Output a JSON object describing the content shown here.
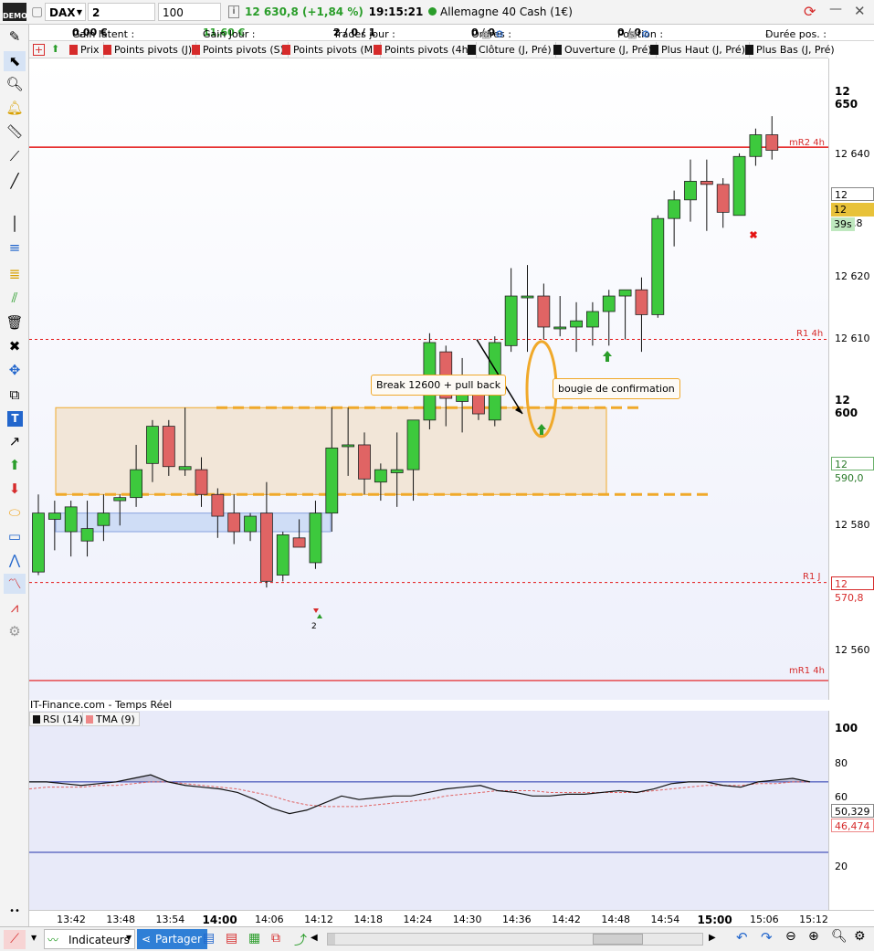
{
  "toolbar": {
    "instrument": "DAX",
    "timeframe": "2 minutes",
    "size": "100 unités",
    "price": "12 630,8 (+1,84 %)",
    "time": "19:15:21",
    "market": "Allemagne 40 Cash (1€)",
    "demo_label": "DEMO"
  },
  "info": {
    "gain_latent_label": "Gain latent :",
    "gain_latent_value": "0,00 €",
    "gain_jour_label": "Gain Jour :",
    "gain_jour_value": "11,60 €",
    "trades_label": "Trades jour :",
    "trades_value": "2 / 0 / 1",
    "ordres_label": "Ordres :",
    "ordres_value_a": "0",
    "ordres_value_b": "0",
    "position_label": "Position :",
    "position_value_a": "0",
    "position_value_b": "0",
    "duree_label": "Durée pos. :",
    "duree_value": "-"
  },
  "indicators": [
    {
      "label": "Prix",
      "color": "#d62b2b"
    },
    {
      "label": "Points pivots (J)",
      "color": "#d62b2b"
    },
    {
      "label": "Points pivots (S)",
      "color": "#d62b2b"
    },
    {
      "label": "Points pivots (M)",
      "color": "#d62b2b"
    },
    {
      "label": "Points pivots (4h)",
      "color": "#d62b2b"
    },
    {
      "label": "Clôture (J, Pré)",
      "color": "#111111"
    },
    {
      "label": "Ouverture (J, Pré)",
      "color": "#111111"
    },
    {
      "label": "Plus Haut (J, Pré)",
      "color": "#111111"
    },
    {
      "label": "Plus Bas (J, Pré)",
      "color": "#111111"
    }
  ],
  "price_axis": {
    "ticks": [
      "12 650",
      "12 640",
      "12 620",
      "12 610",
      "12 600",
      "12 580",
      "12 560"
    ],
    "tags": {
      "p1": "12 633,3",
      "current": "12 630,8",
      "countdown": "39s",
      "p2": "12 590,0",
      "p3": "12 570,8"
    }
  },
  "levels": {
    "mr2_label": "mR2 4h",
    "r1_4h_label": "R1 4h",
    "r1_j_label": "R1 J",
    "mr1_label": "mR1 4h"
  },
  "annotations": {
    "break": "Break 12600 + pull back",
    "confirm": "bougie de confirmation",
    "trade_count": "2"
  },
  "rsi": {
    "source": "IT-Finance.com - Temps Réel",
    "rsi_label": "RSI (14)",
    "tma_label": "TMA (9)",
    "ticks": [
      "100",
      "80",
      "60",
      "20"
    ],
    "value_rsi": "50,329",
    "value_tma": "46,474"
  },
  "time_axis": {
    "labels": [
      "13:42",
      "13:48",
      "13:54",
      "14:00",
      "14:06",
      "14:12",
      "14:18",
      "14:24",
      "14:30",
      "14:36",
      "14:42",
      "14:48",
      "14:54",
      "15:00",
      "15:06",
      "15:12"
    ]
  },
  "bottombar": {
    "indicateurs": "Indicateurs",
    "partager": "Partager"
  },
  "colors": {
    "bull": "#3dc93d",
    "bear": "#e06464",
    "pivot": "#e41414",
    "zone_fill": "#f2e6d8",
    "zone_border": "#f0a92a",
    "blue_zone": "#c7d8f5"
  }
}
